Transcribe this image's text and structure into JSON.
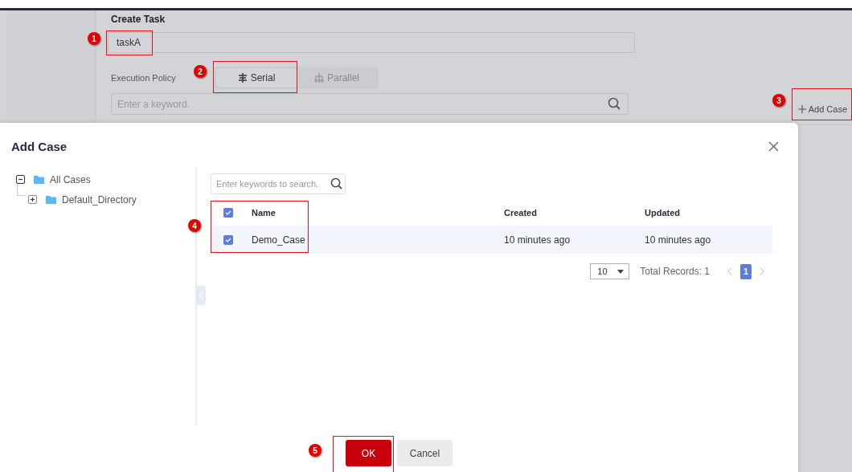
{
  "background_page": {
    "title": "Create Task",
    "task_name": {
      "value": "taskA"
    },
    "execution_policy": {
      "label": "Execution Policy",
      "options": [
        {
          "label": "Serial",
          "selected": true
        },
        {
          "label": "Parallel",
          "selected": false
        }
      ]
    },
    "search": {
      "placeholder": "Enter a keyword."
    },
    "add_case_button": {
      "label": "Add Case"
    }
  },
  "dialog": {
    "title": "Add Case",
    "tree": [
      {
        "label": "All Cases",
        "expanded": true,
        "children": [
          {
            "label": "Default_Directory",
            "expanded": false
          }
        ]
      }
    ],
    "search": {
      "placeholder": "Enter keywords to search."
    },
    "table": {
      "select_all": {
        "checked": true
      },
      "columns": [
        "Name",
        "Created",
        "Updated"
      ],
      "rows": [
        {
          "name": "Demo_Case",
          "created": "10 minutes ago",
          "updated": "10 minutes ago",
          "checked": true,
          "selected": true
        }
      ]
    },
    "pagination": {
      "page_size": "10",
      "total": "Total Records: 1",
      "pages": [
        {
          "label": "1",
          "selected": true
        }
      ]
    },
    "buttons": [
      {
        "label": "OK",
        "kind": "primary"
      },
      {
        "label": "Cancel",
        "kind": "secondary"
      }
    ]
  },
  "annotations": [
    {
      "number": "1"
    },
    {
      "number": "2"
    },
    {
      "number": "3"
    },
    {
      "number": "4"
    },
    {
      "number": "5"
    }
  ]
}
